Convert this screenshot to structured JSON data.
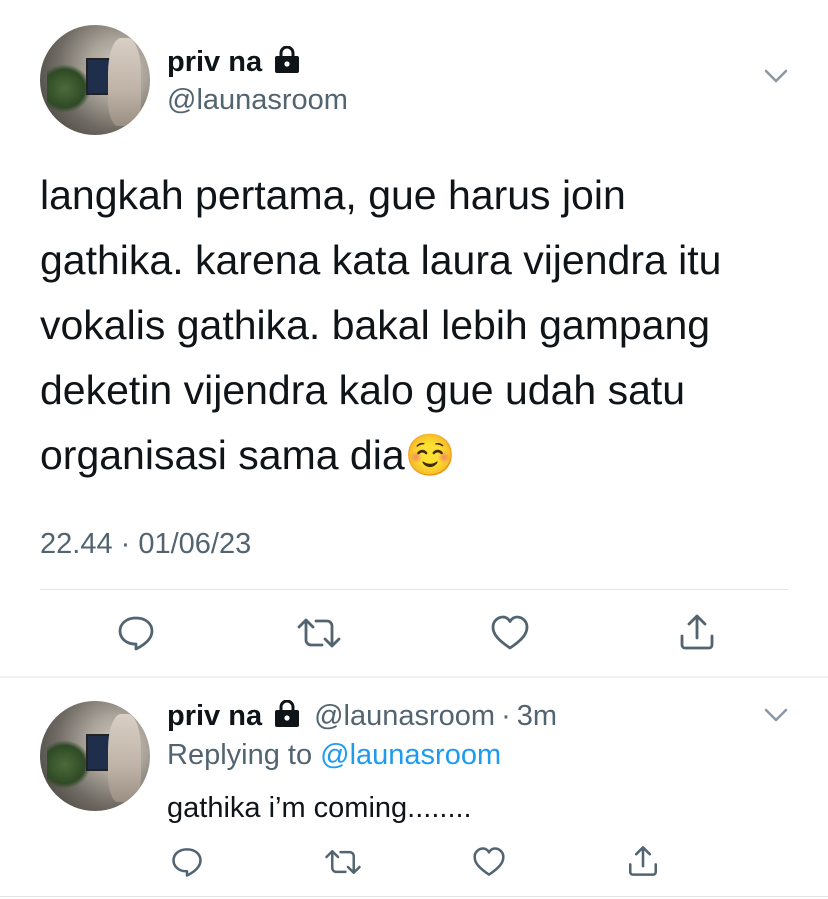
{
  "main_tweet": {
    "display_name": "priv na",
    "handle": "@launasroom",
    "text_lines": [
      "langkah pertama, gue harus join",
      "gathika. karena kata laura vijendra itu",
      "vokalis gathika. bakal lebih gampang",
      "deketin vijendra kalo gue udah satu",
      "organisasi sama dia☺️"
    ],
    "timestamp": "22.44 · 01/06/23"
  },
  "reply_tweet": {
    "display_name": "priv na",
    "handle": "@launasroom",
    "separator": "·",
    "age": "3m",
    "replying_prefix": "Replying to",
    "replying_to": "@launasroom",
    "text": "gathika i’m coming........"
  },
  "icons": {
    "lock": "lock-icon",
    "more": "chevron-down-icon",
    "reply": "comment-icon",
    "retweet": "retweet-icon",
    "like": "heart-icon",
    "share": "share-icon"
  },
  "colors": {
    "text": "#0f1419",
    "secondary": "#536471",
    "link": "#1d9bf0",
    "divider": "#e1e4e8"
  }
}
